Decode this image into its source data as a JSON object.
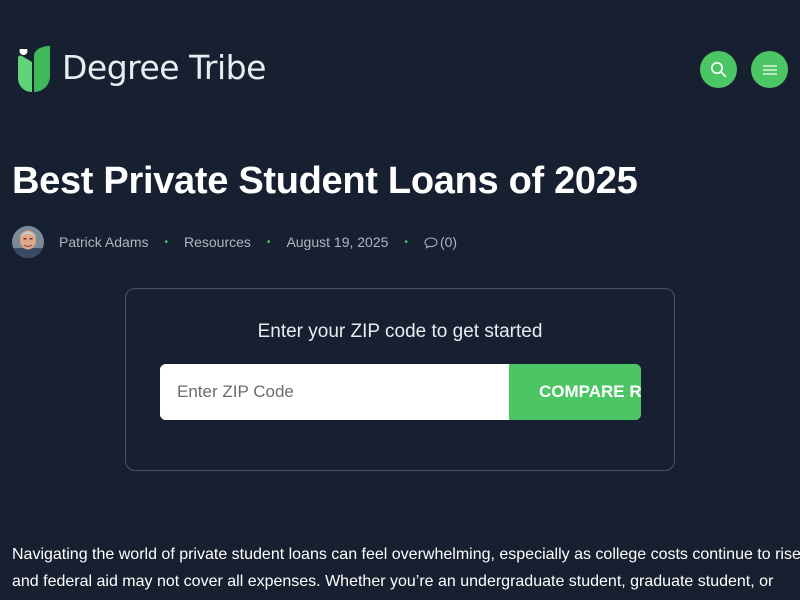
{
  "header": {
    "logo_text": "Degree Tribe",
    "logo_icon": "degree-tribe-leaf-logo",
    "search_icon": "search-icon",
    "menu_icon": "hamburger-menu-icon",
    "accent_color": "#4cc565",
    "background_color": "#172030"
  },
  "article": {
    "title": "Best Private Student Loans of 2025",
    "author": "Patrick Adams",
    "category": "Resources",
    "date": "August 19, 2025",
    "comments": "(0)"
  },
  "zip_widget": {
    "heading": "Enter your ZIP code to get started",
    "placeholder": "Enter ZIP Code",
    "button_label": "COMPARE RATES"
  },
  "body": {
    "intro": "Navigating the world of private student loans can feel overwhelming, especially as college costs continue to rise and federal aid may not cover all expenses. Whether you’re an undergraduate student, graduate student, or"
  }
}
